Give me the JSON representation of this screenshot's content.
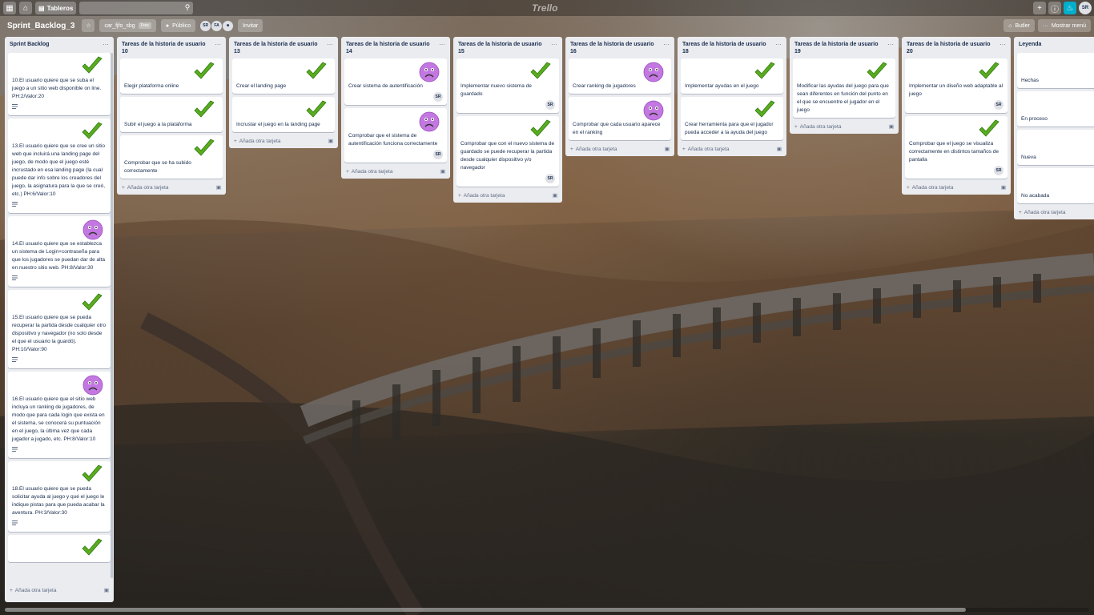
{
  "header": {
    "boards_label": "Tableros",
    "logo": "Trello",
    "avatar": "SR",
    "icons": [
      "apps-icon",
      "home-icon",
      "board-icon",
      "search-icon",
      "plus-icon",
      "info-icon",
      "bell-icon"
    ]
  },
  "board": {
    "title": "Sprint_Backlog_3",
    "team": "car_fjfo_sbg",
    "plan_badge": "Free",
    "visibility": "Público",
    "members": [
      "SR",
      "FA"
    ],
    "invite": "Invitar",
    "butler": "Butler",
    "show_menu": "Mostrar menú"
  },
  "add_card_label": "Añada otra tarjeta",
  "lists": [
    {
      "title": "Sprint Backlog",
      "cards": [
        {
          "text": "10.El usuario quiere que se suba el juego a un sitio web disponible on line. PH:2/Valor:20",
          "cover": "check",
          "desc": true
        },
        {
          "text": "13.El usuario quiere que se cree un sitio web que incluirá una landing page del juego, de modo que el juego esté incrustado en esa landing page (la cual puede dar info sobre los creadores del juego, la asignatura para la que se creó, etc.) PH:6/Valor:10",
          "cover": "check",
          "desc": true
        },
        {
          "text": "14.El usuario quiere que se establezca un sistema de Login+contraseña para que los jugadores se puedan dar de alta en nuestro sitio web. PH:8/Valor:30",
          "cover": "sad",
          "desc": true
        },
        {
          "text": "15.El usuario quiere que se pueda recuperar la partida desde cualquier otro dispositivo y navegador (no solo desde el que el usuario la guardó). PH:10/Valor:90",
          "cover": "check",
          "desc": true
        },
        {
          "text": "16.El usuario quiere que el sitio web incluya un ranking de jugadores, de modo que para cada login que exista en el sistema, se conocerá su puntuación en el juego, la última vez que cada jugador a jugado, etc. PH:8/Valor:10",
          "cover": "sad",
          "desc": true
        },
        {
          "text": "18.El usuario quiere que se pueda solicitar ayuda al juego y qué el juego le indique pistas para que pueda acabar la aventura. PH:3/Valor:30",
          "cover": "check",
          "desc": true
        },
        {
          "text": "",
          "cover": "check",
          "desc": false
        }
      ]
    },
    {
      "title": "Tareas de la historia de usuario 10",
      "cards": [
        {
          "text": "Elegir plataforma online",
          "cover": "check"
        },
        {
          "text": "Subir el juego a la plataforma",
          "cover": "check"
        },
        {
          "text": "Comprobar que se ha subido correctamente",
          "cover": "check"
        }
      ]
    },
    {
      "title": "Tareas de la historia de usuario 13",
      "cards": [
        {
          "text": "Crear el landing page",
          "cover": "check"
        },
        {
          "text": "Incrustar el juego en la landing page",
          "cover": "check"
        }
      ]
    },
    {
      "title": "Tareas de la historia de usuario 14",
      "cards": [
        {
          "text": "Crear sistema de autentificación",
          "cover": "sad",
          "member": "SR"
        },
        {
          "text": "Comprobar que el sistema de autentificación funciona correctamente",
          "cover": "sad",
          "member": "SR"
        }
      ]
    },
    {
      "title": "Tareas de la historia de usuario 15",
      "cards": [
        {
          "text": "Implementar nuevo sistema de guardado",
          "cover": "check",
          "member": "SR"
        },
        {
          "text": "Comprobar que con el nuevo sistema de guardado se puede recuperar la partida desde cualquier dispositivo y/o navegador",
          "cover": "check",
          "member": "SR"
        }
      ]
    },
    {
      "title": "Tareas de la historia de usuario 16",
      "cards": [
        {
          "text": "Crear ranking de jugadores",
          "cover": "sad"
        },
        {
          "text": "Comprobar que cada usuario aparece en el ranking",
          "cover": "sad"
        }
      ]
    },
    {
      "title": "Tareas de la historia de usuario 18",
      "cards": [
        {
          "text": "Implementar ayudas en el juego",
          "cover": "check"
        },
        {
          "text": "Crear herramienta para que el jugador pueda acceder a la ayuda del juego",
          "cover": "check"
        }
      ]
    },
    {
      "title": "Tareas de la historia de usuario 19",
      "cards": [
        {
          "text": "Modificar las ayudas del juego para que sean diferentes en función del punto en el que se encuentre el jugador en el juego",
          "cover": "check"
        }
      ]
    },
    {
      "title": "Tareas de la historia de usuario 20",
      "cards": [
        {
          "text": "Implementar un diseño web adaptable al juego",
          "cover": "check",
          "member": "SR"
        },
        {
          "text": "Comprobar que el juego se visualiza correctamente en distintos tamaños de pantalla",
          "cover": "check",
          "member": "SR"
        }
      ]
    },
    {
      "title": "Leyenda",
      "cards": [
        {
          "text": "Hechas",
          "cover": "check-partial"
        },
        {
          "text": "En proceso",
          "cover": "teal-partial"
        },
        {
          "text": "Nueva",
          "cover": "none"
        },
        {
          "text": "No acabada",
          "cover": "sad-partial"
        }
      ]
    }
  ],
  "colors": {
    "check": "#5aac1f",
    "sad": "#c377e0",
    "teal": "#00c2e0"
  }
}
